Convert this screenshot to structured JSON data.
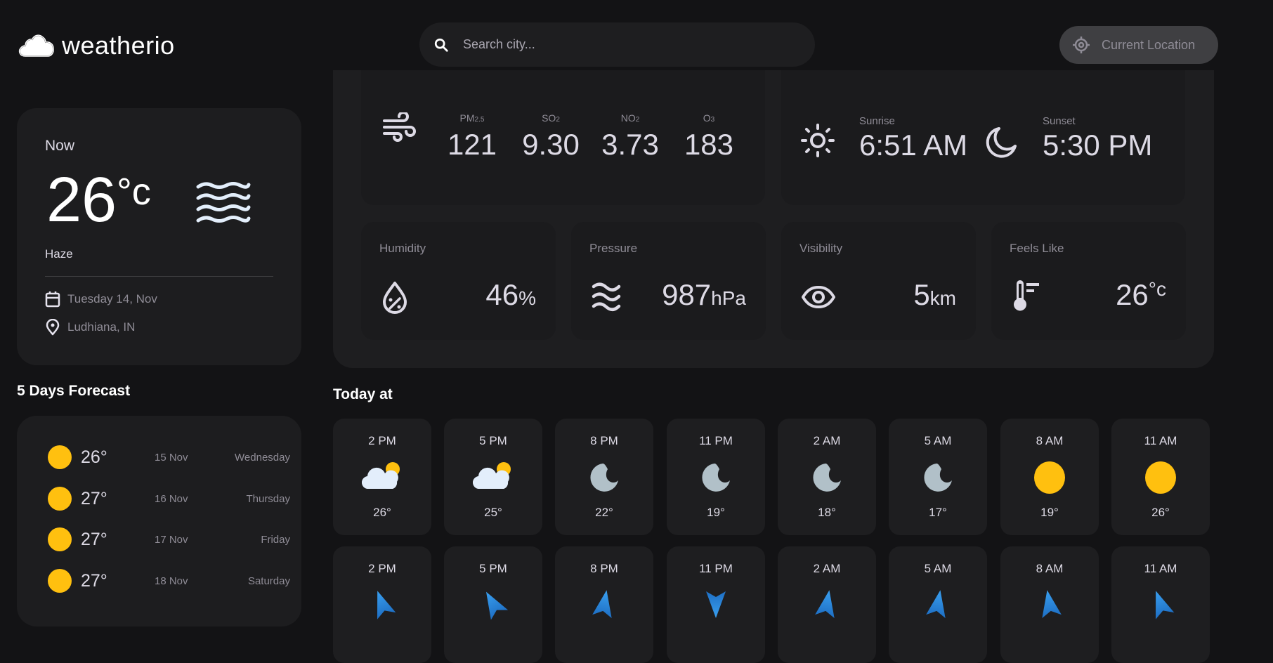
{
  "header": {
    "app_name": "weatherio",
    "search_placeholder": "Search city...",
    "current_location_label": "Current Location"
  },
  "current": {
    "label": "Now",
    "temperature": "26",
    "unit": "°c",
    "condition": "Haze",
    "condition_icon": "haze-icon",
    "date": "Tuesday 14, Nov",
    "location": "Ludhiana, IN"
  },
  "forecast": {
    "title": "5 Days Forecast",
    "items": [
      {
        "icon": "sun-icon",
        "temp": "26°",
        "date": "15 Nov",
        "day": "Wednesday"
      },
      {
        "icon": "sun-icon",
        "temp": "27°",
        "date": "16 Nov",
        "day": "Thursday"
      },
      {
        "icon": "sun-icon",
        "temp": "27°",
        "date": "17 Nov",
        "day": "Friday"
      },
      {
        "icon": "sun-icon",
        "temp": "27°",
        "date": "18 Nov",
        "day": "Saturday"
      }
    ]
  },
  "highlights": {
    "air_quality": {
      "icon": "wind-icon",
      "items": [
        {
          "label": "PM",
          "sub": "2.5",
          "value": "121"
        },
        {
          "label": "SO",
          "sub": "2",
          "value": "9.30"
        },
        {
          "label": "NO",
          "sub": "2",
          "value": "3.73"
        },
        {
          "label": "O",
          "sub": "3",
          "value": "183"
        }
      ]
    },
    "sun": {
      "sunrise_label": "Sunrise",
      "sunrise": "6:51 AM",
      "sunset_label": "Sunset",
      "sunset": "5:30 PM"
    },
    "humidity": {
      "label": "Humidity",
      "value": "46",
      "unit": "%"
    },
    "pressure": {
      "label": "Pressure",
      "value": "987",
      "unit": "hPa"
    },
    "visibility": {
      "label": "Visibility",
      "value": "5",
      "unit": "km"
    },
    "feels_like": {
      "label": "Feels Like",
      "value": "26",
      "unit": "°c"
    }
  },
  "today": {
    "title": "Today at",
    "hourly": [
      {
        "time": "2 PM",
        "icon": "partly-cloudy-day",
        "temp": "26°"
      },
      {
        "time": "5 PM",
        "icon": "partly-cloudy-day",
        "temp": "25°"
      },
      {
        "time": "8 PM",
        "icon": "moon",
        "temp": "22°"
      },
      {
        "time": "11 PM",
        "icon": "moon",
        "temp": "19°"
      },
      {
        "time": "2 AM",
        "icon": "moon",
        "temp": "18°"
      },
      {
        "time": "5 AM",
        "icon": "moon",
        "temp": "17°"
      },
      {
        "time": "8 AM",
        "icon": "sun",
        "temp": "19°"
      },
      {
        "time": "11 AM",
        "icon": "sun",
        "temp": "26°"
      }
    ],
    "wind": [
      {
        "time": "2 PM",
        "direction_deg": 340
      },
      {
        "time": "5 PM",
        "direction_deg": 330
      },
      {
        "time": "8 PM",
        "direction_deg": 10
      },
      {
        "time": "11 PM",
        "direction_deg": 180
      },
      {
        "time": "2 AM",
        "direction_deg": 10
      },
      {
        "time": "5 AM",
        "direction_deg": 10
      },
      {
        "time": "8 AM",
        "direction_deg": 350
      },
      {
        "time": "11 AM",
        "direction_deg": 340
      }
    ]
  },
  "colors": {
    "background": "#131315",
    "card": "#1d1d1f",
    "sun_yellow": "#ffc00f",
    "moon_gray": "#b1c0c8",
    "wind_blue": "#2e90e0",
    "text_primary": "#dddae5",
    "text_muted": "#8f8c96"
  }
}
